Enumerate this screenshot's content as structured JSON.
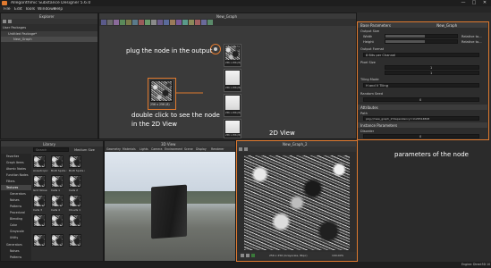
{
  "window": {
    "title": "Allegorithmic Substance Designer 5.6.0",
    "min": "—",
    "max": "□",
    "close": "✕"
  },
  "menu": [
    "File",
    "Edit",
    "Tools",
    "Windows",
    "Help"
  ],
  "explorer": {
    "title": "Explorer",
    "items": [
      "User Packages",
      "Untitled Package*",
      "New_Graph"
    ]
  },
  "graph": {
    "title": "New_Graph",
    "node_sizes": [
      "256 x 256 (8)",
      "256 x 256 (8)",
      "256 x 256 (8)",
      "256 x 256 (8)",
      "256 x 256 (8)"
    ]
  },
  "annotations": {
    "plug": "plug the node in the output",
    "doubleclick_1": "double click to see the node",
    "doubleclick_2": "in the 2D View",
    "view2d": "2D View",
    "params": "parameters of the node"
  },
  "library": {
    "title": "Library",
    "search_placeholder": "Search",
    "filter": "Medium Size",
    "categories": [
      "Favorites",
      "Graph Items",
      "Atomic Nodes",
      "Function Nodes",
      "Filters",
      "Textures",
      "Generators",
      "Noises",
      "Patterns",
      "Procedural",
      "Blending",
      "Color",
      "Grayscale",
      "Utility",
      "Generators",
      "Noises",
      "Patterns"
    ],
    "tiles": [
      "Anisotropic Noise",
      "BnW Spots 1",
      "BnW Spots 2",
      "Grid Noise",
      "Cells 1",
      "Cells 2",
      "Cells 3",
      "Cells 4",
      "Clouds 1",
      "",
      "",
      ""
    ]
  },
  "view3d": {
    "title": "3D View",
    "menu": [
      "Geometry",
      "Materials",
      "Lights",
      "Camera",
      "Environment",
      "Scene",
      "Display",
      "Renderer"
    ]
  },
  "view2d": {
    "title": "New_Graph_2",
    "footer": "256 x 256 (Grayscale, 8bpc)",
    "zoom": "100.00%"
  },
  "params": {
    "title": "Base Parameters",
    "node": "New_Graph",
    "output_size": "Output Size",
    "width": "Width",
    "height": "Height",
    "relative_to_parent": "Relative to...",
    "output_format": "Output Format",
    "format_value": "8 Bits per Channel",
    "pixel_size": "Pixel Size",
    "random_seed": "Random Seed",
    "tiling": "Tiling Mode",
    "tiling_value": "H and V Tiling",
    "attributes": "Attributes",
    "path": "Path",
    "path_value": "pkg:///new_graph_2?dependency=1126514808",
    "instance_params": "Instance Parameters",
    "disorder": "Disorder",
    "value_0": "0",
    "value_1": "1"
  },
  "status": {
    "engine": "Engine: Direct3D 10"
  },
  "colors": {
    "accent": "#e07a2f",
    "background": "#2b2b2b"
  }
}
